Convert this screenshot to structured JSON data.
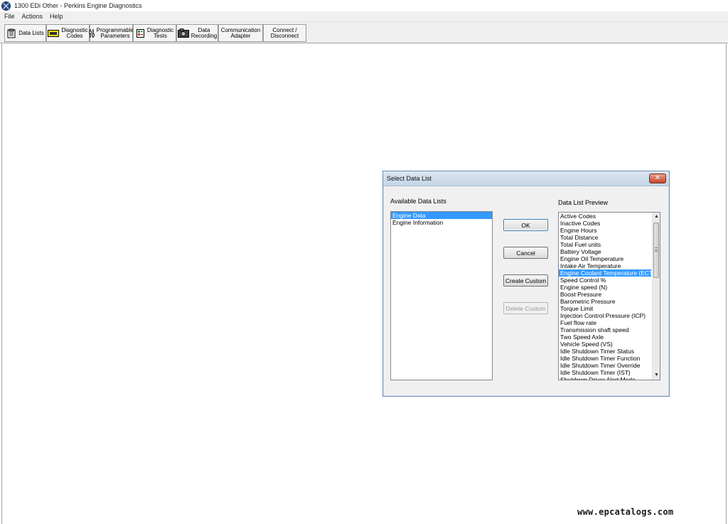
{
  "window": {
    "title": "1300 EDi Other - Perkins Engine Diagnostics"
  },
  "menu": {
    "items": [
      "File",
      "Actions",
      "Help"
    ]
  },
  "toolbar": {
    "data_lists": "Data Lists",
    "diagnostic_codes": [
      "Diagnostic",
      "Codes"
    ],
    "programmable_parameters": [
      "Programmable",
      "Parameters"
    ],
    "diagnostic_tests": [
      "Diagnostic",
      "Tests"
    ],
    "data_recording": [
      "Data",
      "Recording"
    ],
    "communication_adapter": [
      "Communication",
      "Adapter"
    ],
    "connect_disconnect": [
      "Connect /",
      "Disconnect"
    ]
  },
  "dialog": {
    "title": "Select Data List",
    "available_label": "Available Data Lists",
    "preview_label": "Data List Preview",
    "available_items": [
      "Engine Data",
      "Engine Information"
    ],
    "available_selected": 0,
    "preview_items": [
      "Active Codes",
      "Inactive Codes",
      "Engine Hours",
      "Total Distance",
      "Total Fuel units",
      "Battery Voltage",
      "Engine Oil Temperature",
      "Intake Air Temperature",
      "Engine Coolant Temperature (ECT)",
      "Speed Control %",
      "Engine speed (N)",
      "Boost Pressure",
      "Barometric Pressure",
      "Torque Limit",
      "Injection Control Pressure (ICP)",
      "Fuel flow rate",
      "Transmission shaft speed",
      "Two Speed Axle",
      "Vehicle Speed (VS)",
      "Idle Shutdown Timer Status",
      "Idle Shutdown Timer Function",
      "Idle Shutdown Timer Override",
      "Idle Shutdown Timer (IST)",
      "Shutdown Driver Alert Mode"
    ],
    "preview_selected": 8,
    "buttons": {
      "ok": "OK",
      "cancel": "Cancel",
      "create_custom": "Create Custom",
      "delete_custom": "Delete Custom"
    }
  },
  "watermark": "www.epcatalogs.com"
}
